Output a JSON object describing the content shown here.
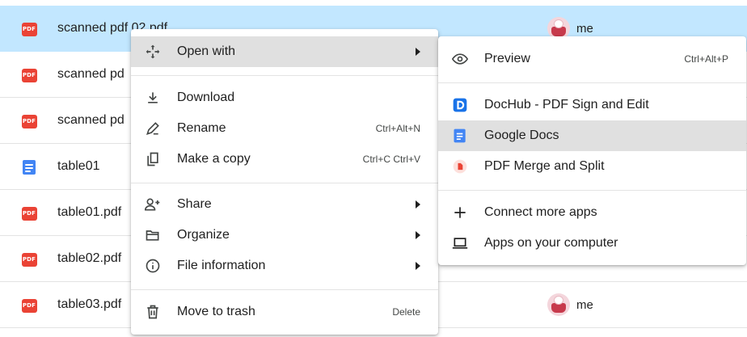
{
  "files": [
    {
      "name": "scanned pdf 02.pdf",
      "type": "pdf",
      "owner": "me",
      "selected": true
    },
    {
      "name": "scanned pd",
      "type": "pdf",
      "owner": ""
    },
    {
      "name": "scanned pd",
      "type": "pdf",
      "owner": ""
    },
    {
      "name": "table01",
      "type": "doc",
      "owner": ""
    },
    {
      "name": "table01.pdf",
      "type": "pdf",
      "owner": ""
    },
    {
      "name": "table02.pdf",
      "type": "pdf",
      "owner": ""
    },
    {
      "name": "table03.pdf",
      "type": "pdf",
      "owner": "me"
    }
  ],
  "pdf_badge_text": "PDF",
  "context_menu": {
    "open_with": "Open with",
    "download": "Download",
    "rename": "Rename",
    "rename_shortcut": "Ctrl+Alt+N",
    "make_copy": "Make a copy",
    "make_copy_shortcut": "Ctrl+C Ctrl+V",
    "share": "Share",
    "organize": "Organize",
    "file_information": "File information",
    "move_to_trash": "Move to trash",
    "move_to_trash_shortcut": "Delete"
  },
  "open_with_menu": {
    "preview": "Preview",
    "preview_shortcut": "Ctrl+Alt+P",
    "dochub": "DocHub - PDF Sign and Edit",
    "google_docs": "Google Docs",
    "pdf_merge": "PDF Merge and Split",
    "connect_more": "Connect more apps",
    "apps_on_computer": "Apps on your computer"
  },
  "colors": {
    "selected_row": "#c2e7ff",
    "pdf_red": "#ea4335",
    "docs_blue": "#4285f4",
    "dochub_blue": "#1a73e8",
    "highlight": "#e0e0e0"
  }
}
